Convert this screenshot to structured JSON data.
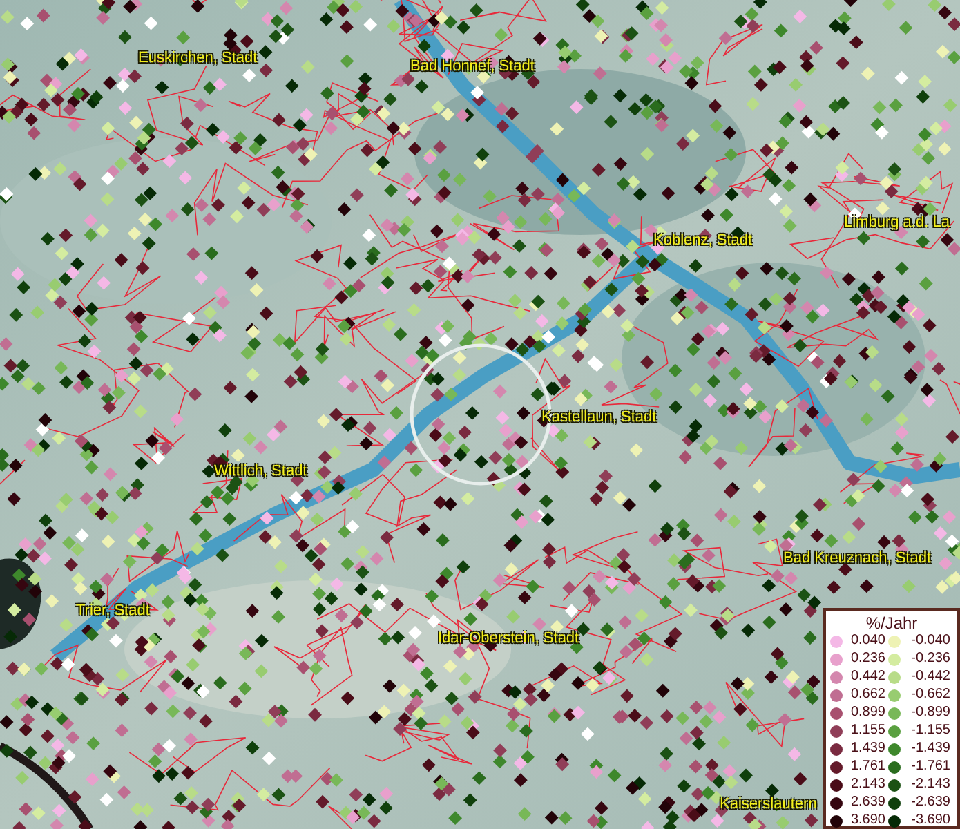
{
  "map": {
    "places": [
      {
        "label": "Euskirchen, Stadt"
      },
      {
        "label": "Bad Honnef, Stadt"
      },
      {
        "label": "Limburg a.d. La"
      },
      {
        "label": "Koblenz, Stadt"
      },
      {
        "label": "Kastellaun, Stadt"
      },
      {
        "label": "Wittlich, Stadt"
      },
      {
        "label": "Bad Kreuznach, Stadt"
      },
      {
        "label": "Trier, Stadt"
      },
      {
        "label": "Idar-Oberstein, Stadt"
      },
      {
        "label": "Kaiserslautern"
      }
    ]
  },
  "legend": {
    "title": "%/Jahr",
    "positive": [
      {
        "label": "0.040",
        "color": "#f4b8e6"
      },
      {
        "label": "0.236",
        "color": "#e8a0cc"
      },
      {
        "label": "0.442",
        "color": "#d487ae"
      },
      {
        "label": "0.662",
        "color": "#c06e92"
      },
      {
        "label": "0.899",
        "color": "#a8506f"
      },
      {
        "label": "1.155",
        "color": "#903e58"
      },
      {
        "label": "1.439",
        "color": "#7a2a40"
      },
      {
        "label": "1.761",
        "color": "#641a2a"
      },
      {
        "label": "2.143",
        "color": "#4a0c18"
      },
      {
        "label": "2.639",
        "color": "#360610"
      },
      {
        "label": "3.690",
        "color": "#220308"
      }
    ],
    "negative": [
      {
        "label": "-0.040",
        "color": "#eef2b4"
      },
      {
        "label": "-0.236",
        "color": "#d4eca0"
      },
      {
        "label": "-0.442",
        "color": "#b8dc88"
      },
      {
        "label": "-0.662",
        "color": "#98cc70"
      },
      {
        "label": "-0.899",
        "color": "#78b858"
      },
      {
        "label": "-1.155",
        "color": "#5aa040"
      },
      {
        "label": "-1.439",
        "color": "#3e882c"
      },
      {
        "label": "-1.761",
        "color": "#2a6c1e"
      },
      {
        "label": "-2.143",
        "color": "#1c5214"
      },
      {
        "label": "-2.639",
        "color": "#10400c"
      },
      {
        "label": "-3.690",
        "color": "#062a06"
      }
    ]
  }
}
